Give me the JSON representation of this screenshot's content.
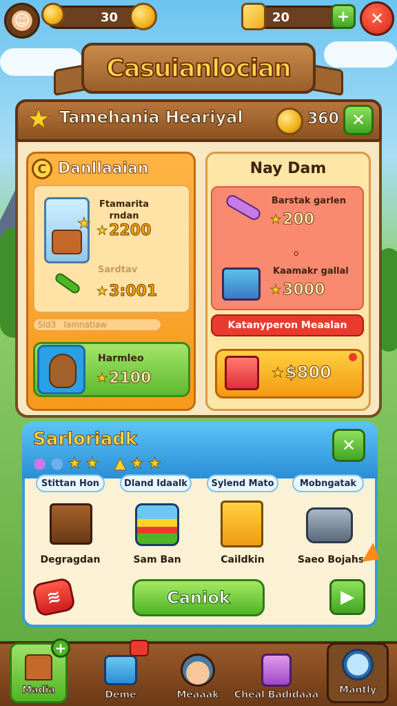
{
  "hud": {
    "coins_value": "30",
    "gems_value": "20",
    "plus_symbol": "+",
    "close_symbol": "✕"
  },
  "title_banner": "Casuianlocian",
  "main_panel": {
    "title": "Tamehania Heariyal",
    "currency_value": "360",
    "close_symbol": "✕",
    "left_card": {
      "title": "Danllaaian",
      "item1": {
        "label": "Ftamarita\nrndan",
        "price": "2200"
      },
      "item2": {
        "label": "Sardtav",
        "price": "3:001"
      },
      "progress_text": "Sld3   lamnatiaw",
      "item3": {
        "label": "Harmleo",
        "price": "2100"
      }
    },
    "right_card": {
      "title": "Nay Dam",
      "item1": {
        "label": "Barstak garlen",
        "price": "200"
      },
      "separator": "o",
      "item2": {
        "label": "Kaamakr gallal",
        "price": "3000"
      },
      "red_bar": "Katanyperon Meaalan",
      "big_button_price": "$800"
    }
  },
  "bottom_panel": {
    "title": "Sarloriadk",
    "close_symbol": "✕",
    "categories": [
      "Stittan Hon",
      "Dland Idaalk",
      "Sylend Mato",
      "Mobngatak"
    ],
    "items": [
      "Degragdan",
      "Sam Ban",
      "Caildkin",
      "Saeo Bojahs"
    ],
    "cta_label": "Caniok"
  },
  "nav": {
    "items": [
      "Madia",
      "Deme",
      "Meaaak",
      "Cheal Badidaaa",
      "Mantly"
    ]
  },
  "colors": {
    "sky": "#6cc4f0",
    "wood": "#8c5221",
    "orange_card": "#f79a1c",
    "green": "#4eb524",
    "blue_header": "#2a8ed6",
    "red": "#e83b2e"
  }
}
